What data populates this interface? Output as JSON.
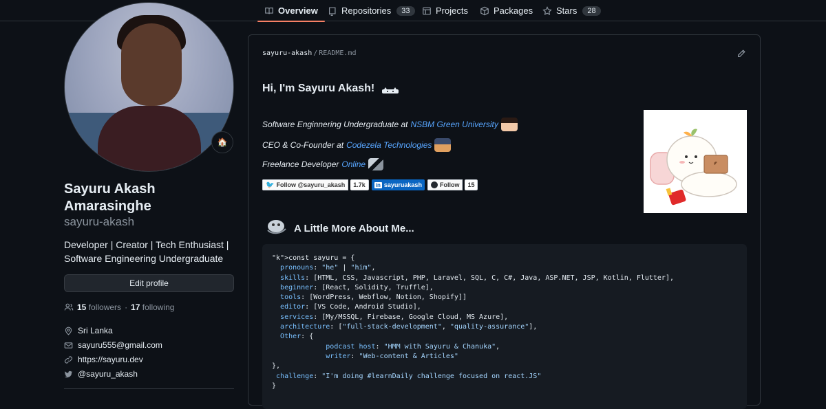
{
  "tabs": [
    {
      "label": "Overview",
      "count": null
    },
    {
      "label": "Repositories",
      "count": "33"
    },
    {
      "label": "Projects",
      "count": null
    },
    {
      "label": "Packages",
      "count": null
    },
    {
      "label": "Stars",
      "count": "28"
    }
  ],
  "profile": {
    "name": "Sayuru Akash Amarasinghe",
    "login": "sayuru-akash",
    "bio": "Developer | Creator | Tech Enthusiast | Software Engineering Undergraduate",
    "edit_label": "Edit profile",
    "followers_count": "15",
    "followers_label": "followers",
    "dot": "·",
    "following_count": "17",
    "following_label": "following",
    "location": "Sri Lanka",
    "email": "sayuru555@gmail.com",
    "website": "https://sayuru.dev",
    "twitter": "@sayuru_akash"
  },
  "readme": {
    "owner": "sayuru-akash",
    "slash": "/",
    "file": "README.md",
    "title": "Hi, I'm Sayuru Akash!",
    "line1_text": "Software Enginnering Undergraduate at",
    "line1_link": "NSBM Green University",
    "line2_text": "CEO & Co-Founder at",
    "line2_link": "Codezela Technologies",
    "line3_text": "Freelance Developer",
    "line3_link": "Online",
    "badge_twitter": "Follow @sayuru_akash",
    "badge_twitter_count": "1.7k",
    "badge_linkedin": "sayuruakash",
    "badge_github": "Follow",
    "badge_github_count": "15",
    "more_heading": "A Little More About Me..."
  },
  "code_lines": [
    "const sayuru = {",
    "  pronouns: \"he\" | \"him\",",
    "  skills: [HTML, CSS, Javascript, PHP, Laravel, SQL, C, C#, Java, ASP.NET, JSP, Kotlin, Flutter],",
    "  beginner: [React, Solidity, Truffle],",
    "  tools: [WordPress, Webflow, Notion, Shopify]]",
    "  editor: [VS Code, Android Studio],",
    "  services: [My/MSSQL, Firebase, Google Cloud, MS Azure],",
    "  architecture: [\"full-stack-development\", \"quality-assurance\"],",
    "  Other: {",
    "             podcast host: \"HMM with Sayuru & Chanuka\",",
    "             writer: \"Web-content & Articles\"",
    "},",
    " challenge: \"I'm doing #learnDaily challenge focused on react.JS\"",
    "}"
  ],
  "colors": {
    "accent": "#f78166",
    "link": "#58a6ff",
    "bg": "#0d1117",
    "border": "#30363d",
    "linkedin": "#0a66c2"
  },
  "icons": [
    "book-icon",
    "repo-icon",
    "table-icon",
    "package-icon",
    "star-icon",
    "people-icon",
    "location-icon",
    "mail-icon",
    "link-icon",
    "twitter-icon",
    "pencil-icon"
  ]
}
